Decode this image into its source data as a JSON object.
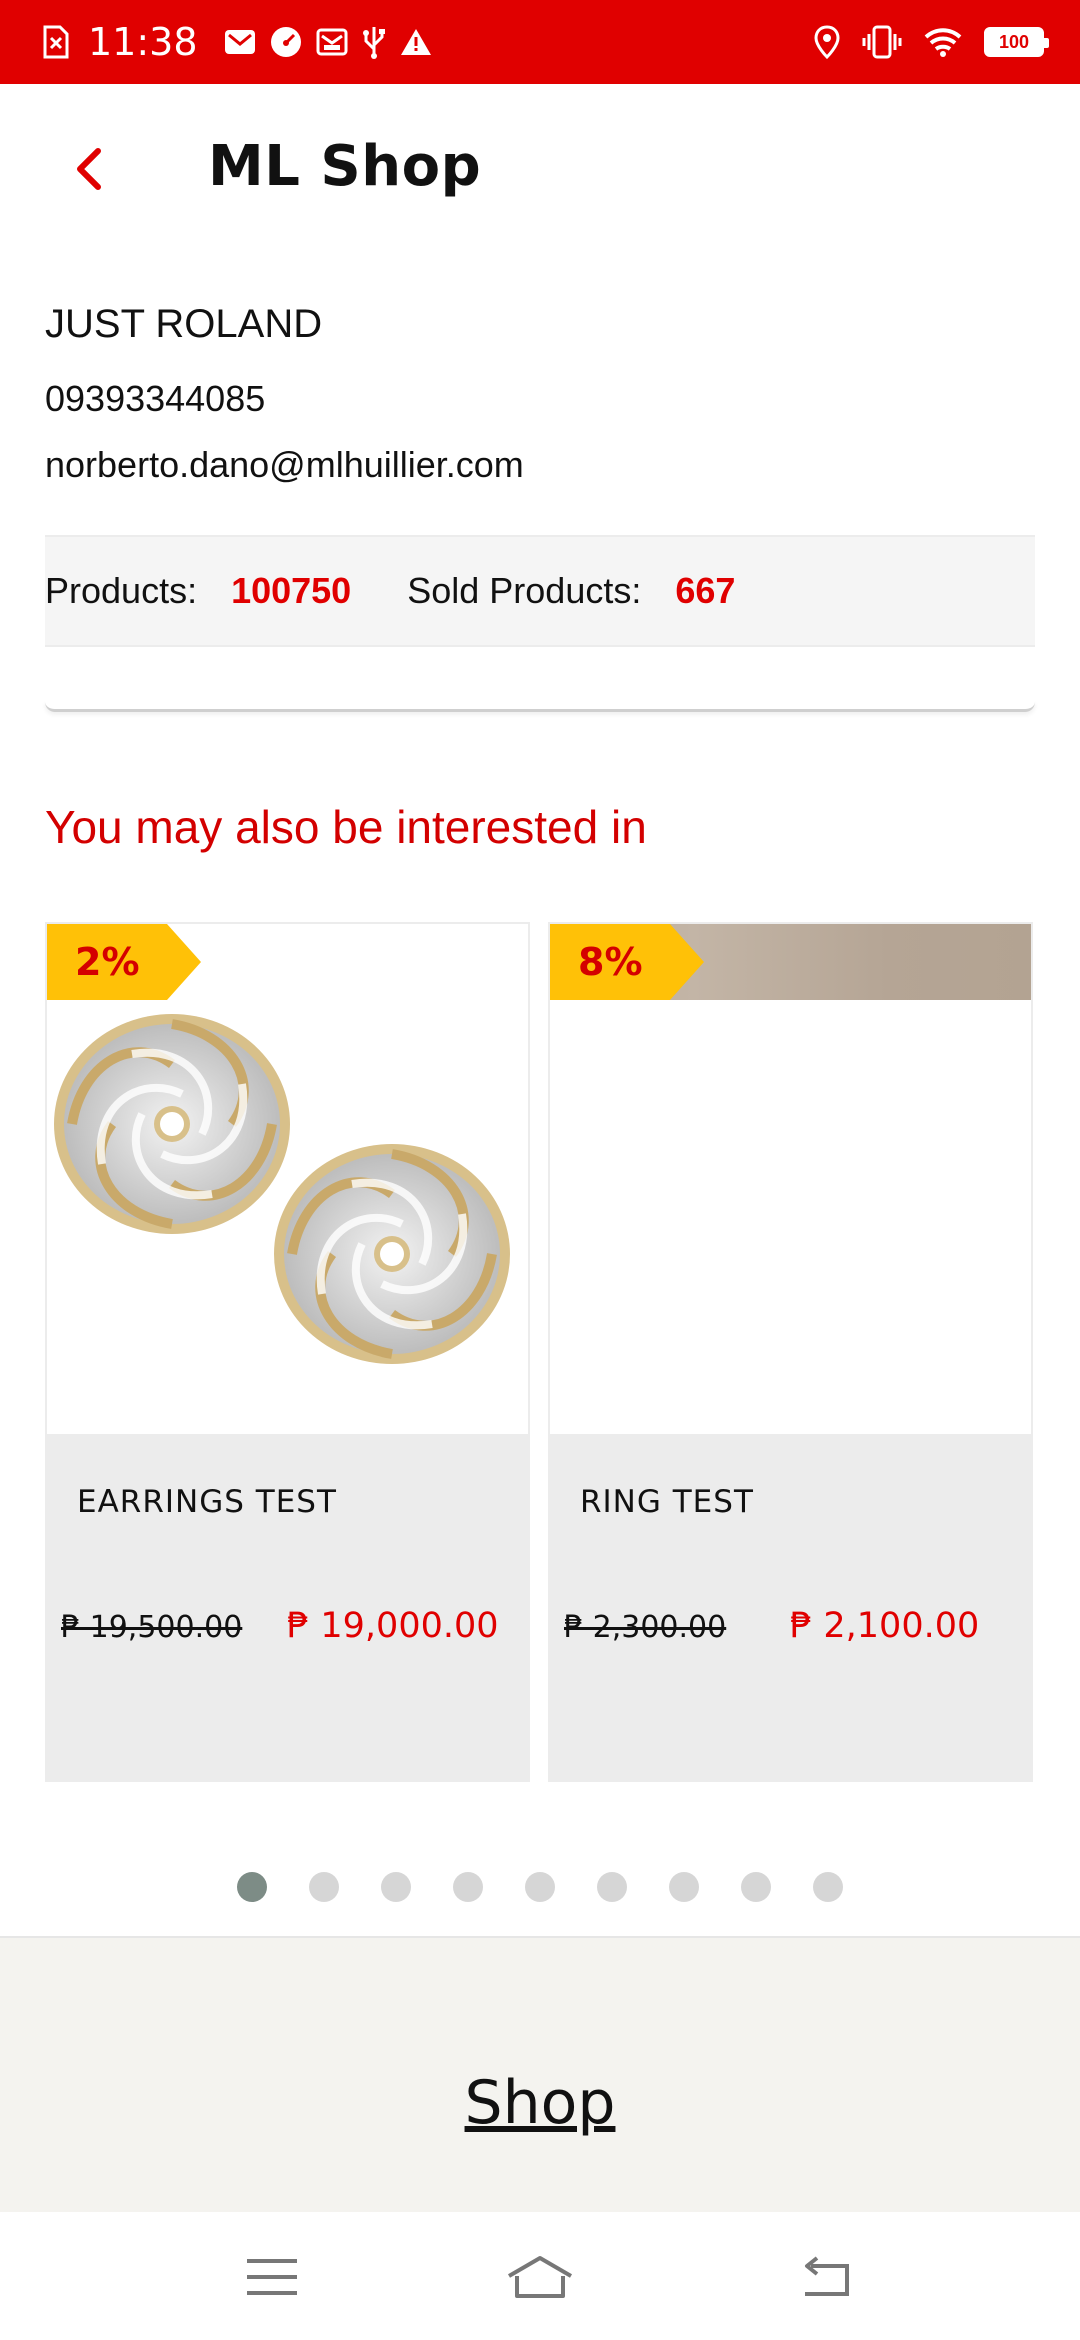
{
  "status_bar": {
    "time": "11:38",
    "battery": "100",
    "left_icons": [
      "sim-error-icon",
      "gmail-icon",
      "speedometer-icon",
      "mail-icon",
      "usb-icon",
      "warning-icon"
    ],
    "right_icons": [
      "location-icon",
      "vibrate-icon",
      "wifi-icon",
      "battery-icon"
    ],
    "color": "#e00000"
  },
  "header": {
    "title": "ML Shop",
    "back_icon": "chevron-left-icon"
  },
  "shop": {
    "name": "JUST ROLAND",
    "phone": "09393344085",
    "email": "norberto.dano@mlhuillier.com",
    "products_label": "Products:",
    "products_value": "100750",
    "sold_label": "Sold Products:",
    "sold_value": "667"
  },
  "recommendations": {
    "title": "You may also be interested in",
    "items": [
      {
        "discount": "2%",
        "name": "EARRINGS TEST",
        "old_price": "₱ 19,500.00",
        "new_price": "₱ 19,000.00",
        "image": "earrings-image"
      },
      {
        "discount": "8%",
        "name": "RING TEST",
        "old_price": "₱ 2,300.00",
        "new_price": "₱ 2,100.00",
        "image": "ring-image"
      }
    ]
  },
  "pagination": {
    "count": 9,
    "active_index": 0
  },
  "footer": {
    "link": "Shop"
  },
  "nav_bar": {
    "icons": [
      "menu-icon",
      "home-icon",
      "back-icon"
    ]
  },
  "colors": {
    "accent": "#e00000",
    "discount_badge": "#ffc107",
    "card_info_bg": "#ececec"
  }
}
